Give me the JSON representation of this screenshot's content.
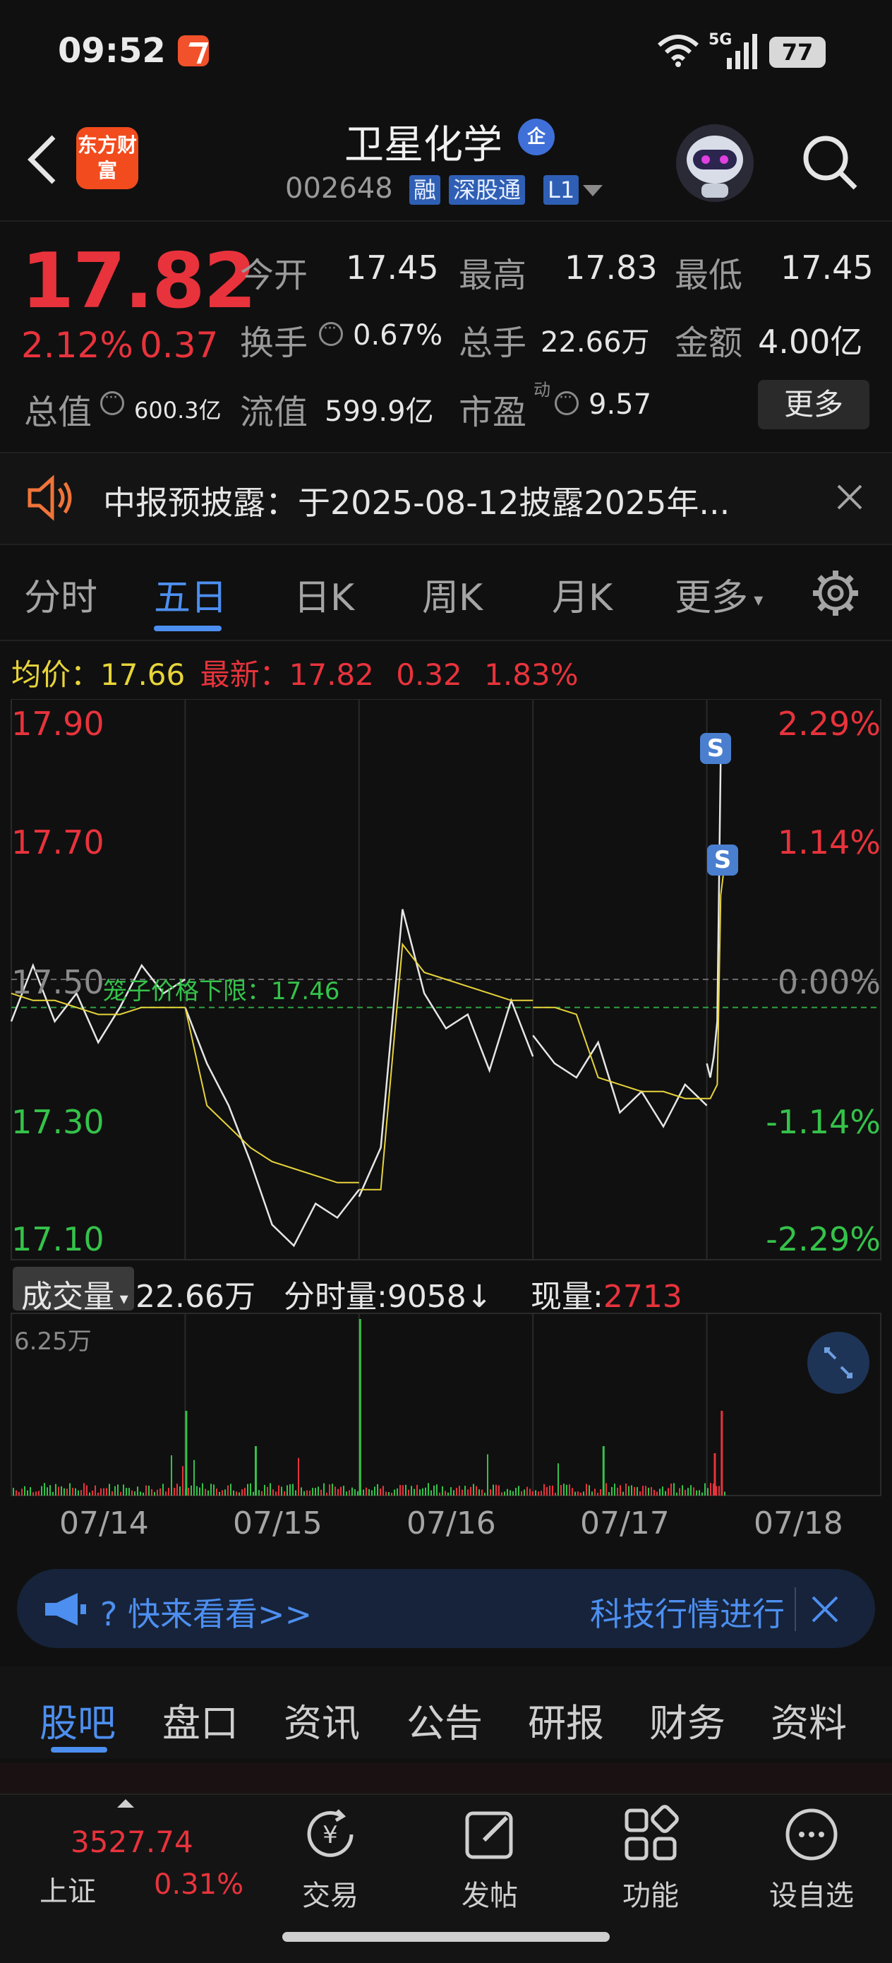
{
  "status": {
    "time": "09:52",
    "network": "5G",
    "battery": "77"
  },
  "header": {
    "logo": "东方财富",
    "name": "卫星化学",
    "badge": "企",
    "code": "002648",
    "tags": [
      "融",
      "深股通",
      "L1"
    ]
  },
  "quote": {
    "price": "17.82",
    "change_pct": "2.12%",
    "change": "0.37",
    "rows": [
      [
        {
          "label": "今开",
          "value": "17.45"
        },
        {
          "label": "最高",
          "value": "17.83"
        },
        {
          "label": "最低",
          "value": "17.45"
        }
      ],
      [
        {
          "label": "换手",
          "value": "0.67%"
        },
        {
          "label": "总手",
          "value": "22.66万"
        },
        {
          "label": "金额",
          "value": "4.00亿"
        }
      ],
      [
        {
          "label": "总值",
          "value": "600.3亿"
        },
        {
          "label": "流值",
          "value": "599.9亿"
        },
        {
          "label": "市盈",
          "sup": "动",
          "value": "9.57"
        }
      ]
    ],
    "more": "更多"
  },
  "notice": {
    "text": "中报预披露：于2025-08-12披露2025年..."
  },
  "tabs": [
    "分时",
    "五日",
    "日K",
    "周K",
    "月K",
    "更多"
  ],
  "active_tab": "五日",
  "avg": {
    "label": "均价：",
    "value": "17.66",
    "latest_label": "最新：",
    "latest": "17.82",
    "chg": "0.32",
    "pct": "1.83%"
  },
  "chart": {
    "y_left": [
      "17.90",
      "17.70",
      "17.50",
      "17.30",
      "17.10"
    ],
    "y_right": [
      "2.29%",
      "1.14%",
      "0.00%",
      "-1.14%",
      "-2.29%"
    ],
    "limit_label": "笼子价格下限：17.46",
    "marker": "S",
    "dates": [
      "07/14",
      "07/15",
      "07/16",
      "07/17",
      "07/18"
    ]
  },
  "chart_data": {
    "type": "line",
    "title": "",
    "x": [
      "07/14",
      "07/15",
      "07/16",
      "07/17",
      "07/18"
    ],
    "ylim": [
      17.1,
      17.9
    ],
    "reference_price": 17.5,
    "lower_limit": 17.46,
    "series": [
      {
        "values": [
          17.44,
          17.52,
          17.44,
          17.48,
          17.41,
          17.46,
          17.52,
          17.48,
          17.5,
          17.46,
          17.38,
          17.32,
          17.24,
          17.15,
          17.12,
          17.18,
          17.16,
          17.2,
          17.19,
          17.26,
          17.6,
          17.48,
          17.43,
          17.45,
          17.37,
          17.47,
          17.39,
          17.42,
          17.38,
          17.36,
          17.41,
          17.31,
          17.34,
          17.29,
          17.35,
          17.32,
          17.38,
          17.36,
          17.39,
          17.44,
          17.82,
          17.83
        ]
      },
      {
        "values": [
          17.48,
          17.47,
          17.47,
          17.46,
          17.45,
          17.45,
          17.46,
          17.46,
          17.46,
          17.46,
          17.32,
          17.29,
          17.26,
          17.24,
          17.23,
          17.22,
          17.21,
          17.21,
          17.2,
          17.2,
          17.55,
          17.51,
          17.5,
          17.49,
          17.48,
          17.47,
          17.47,
          17.46,
          17.46,
          17.45,
          17.36,
          17.35,
          17.34,
          17.34,
          17.33,
          17.33,
          17.33,
          17.33,
          17.34,
          17.35,
          17.62,
          17.66
        ]
      }
    ]
  },
  "volume": {
    "label": "成交量",
    "total": "22.66万",
    "tick_label": "分时量:9058↓",
    "now_label": "现量:",
    "now_value": "2713",
    "max": "6.25万"
  },
  "promo": {
    "left": "?  快来看看>>",
    "right": "科技行情进行"
  },
  "bottom_tabs": [
    "股吧",
    "盘口",
    "资讯",
    "公告",
    "研报",
    "财务",
    "资料"
  ],
  "index": {
    "value": "3527.74",
    "name": "上证",
    "pct": "0.31%"
  },
  "dock": [
    "交易",
    "发帖",
    "功能",
    "设自选"
  ]
}
